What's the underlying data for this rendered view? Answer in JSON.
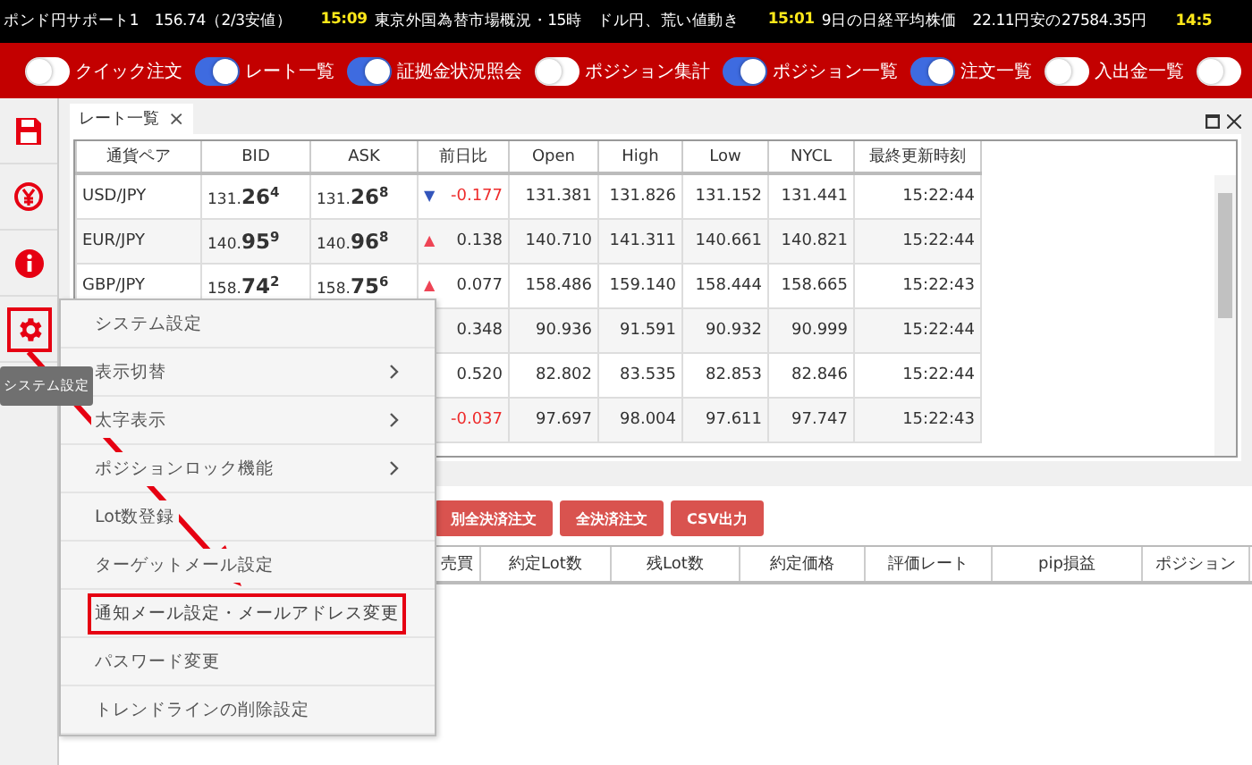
{
  "ticker": [
    {
      "text": "ポンド円サポート1　156.74（2/3安値）"
    },
    {
      "time": "15:09",
      "text": "東京外国為替市場概況・15時　ドル円、荒い値動き"
    },
    {
      "time": "15:01",
      "text": "9日の日経平均株価　22.11円安の27584.35円"
    },
    {
      "time": "14:5"
    }
  ],
  "toolbar": [
    {
      "label": "クイック注文",
      "on": false
    },
    {
      "label": "レート一覧",
      "on": true
    },
    {
      "label": "証拠金状況照会",
      "on": true
    },
    {
      "label": "ポジション集計",
      "on": false
    },
    {
      "label": "ポジション一覧",
      "on": true
    },
    {
      "label": "注文一覧",
      "on": true
    },
    {
      "label": "入出金一覧",
      "on": false
    },
    {
      "on": false
    }
  ],
  "sidebar": [
    {
      "kind": "save"
    },
    {
      "kind": "yen"
    },
    {
      "kind": "info"
    },
    {
      "kind": "settings",
      "highlighted": true
    }
  ],
  "tooltip": "システム設定",
  "rate_panel": {
    "tab": "レート一覧",
    "close": "×",
    "columns": [
      "通貨ペア",
      "BID",
      "ASK",
      "前日比",
      "Open",
      "High",
      "Low",
      "NYCL",
      "最終更新時刻"
    ],
    "rows": [
      {
        "pair": "USD/JPY",
        "bid": "131.**26**$^{4}$",
        "ask": "131.**26**$^{8}$",
        "arrow": "▼",
        "change": "-0.177",
        "negative": true,
        "open": "131.381",
        "high": "131.826",
        "low": "131.152",
        "nycl": "131.441",
        "time": "15:22:44"
      },
      {
        "pair": "EUR/JPY",
        "bid": "140.**95**$^{9}$",
        "ask": "140.**96**$^{8}$",
        "arrow": "▲",
        "change": "0.138",
        "negative": false,
        "open": "140.710",
        "high": "141.311",
        "low": "140.661",
        "nycl": "140.821",
        "time": "15:22:44"
      },
      {
        "pair": "GBP/JPY",
        "bid": "158.**74**$^{2}$",
        "ask": "158.**75**$^{6}$",
        "arrow": "▲",
        "change": "0.077",
        "negative": false,
        "open": "158.486",
        "high": "159.140",
        "low": "158.444",
        "nycl": "158.665",
        "time": "15:22:43"
      },
      {
        "change": "0.348",
        "negative": false,
        "open": "90.936",
        "high": "91.591",
        "low": "90.932",
        "nycl": "90.999",
        "time": "15:22:44"
      },
      {
        "change": "0.520",
        "negative": false,
        "open": "82.802",
        "high": "83.535",
        "low": "82.853",
        "nycl": "82.846",
        "time": "15:22:44"
      },
      {
        "change": "-0.037",
        "negative": true,
        "open": "97.697",
        "high": "98.004",
        "low": "97.611",
        "nycl": "97.747",
        "time": "15:22:43"
      }
    ]
  },
  "position_panel": {
    "buttons": [
      "別全決済注文",
      "全決済注文",
      "CSV出力"
    ],
    "columns": [
      "売買",
      "約定Lot数",
      "残Lot数",
      "約定価格",
      "評価レート",
      "pip損益",
      "ポジション"
    ]
  },
  "menu": [
    {
      "label": "システム設定",
      "submenu": false,
      "highlighted": false
    },
    {
      "label": "表示切替",
      "submenu": true,
      "highlighted": false
    },
    {
      "label": "太字表示",
      "submenu": true,
      "highlighted": false
    },
    {
      "label": "ポジションロック機能",
      "submenu": true,
      "highlighted": false
    },
    {
      "label": "Lot数登録",
      "submenu": false,
      "highlighted": false
    },
    {
      "label": "ターゲットメール設定",
      "submenu": false,
      "highlighted": false
    },
    {
      "label": "通知メール設定・メールアドレス変更",
      "submenu": false,
      "highlighted": true
    },
    {
      "label": "パスワード変更",
      "submenu": false,
      "highlighted": false
    },
    {
      "label": "トレンドラインの削除設定",
      "submenu": false,
      "highlighted": false
    }
  ]
}
